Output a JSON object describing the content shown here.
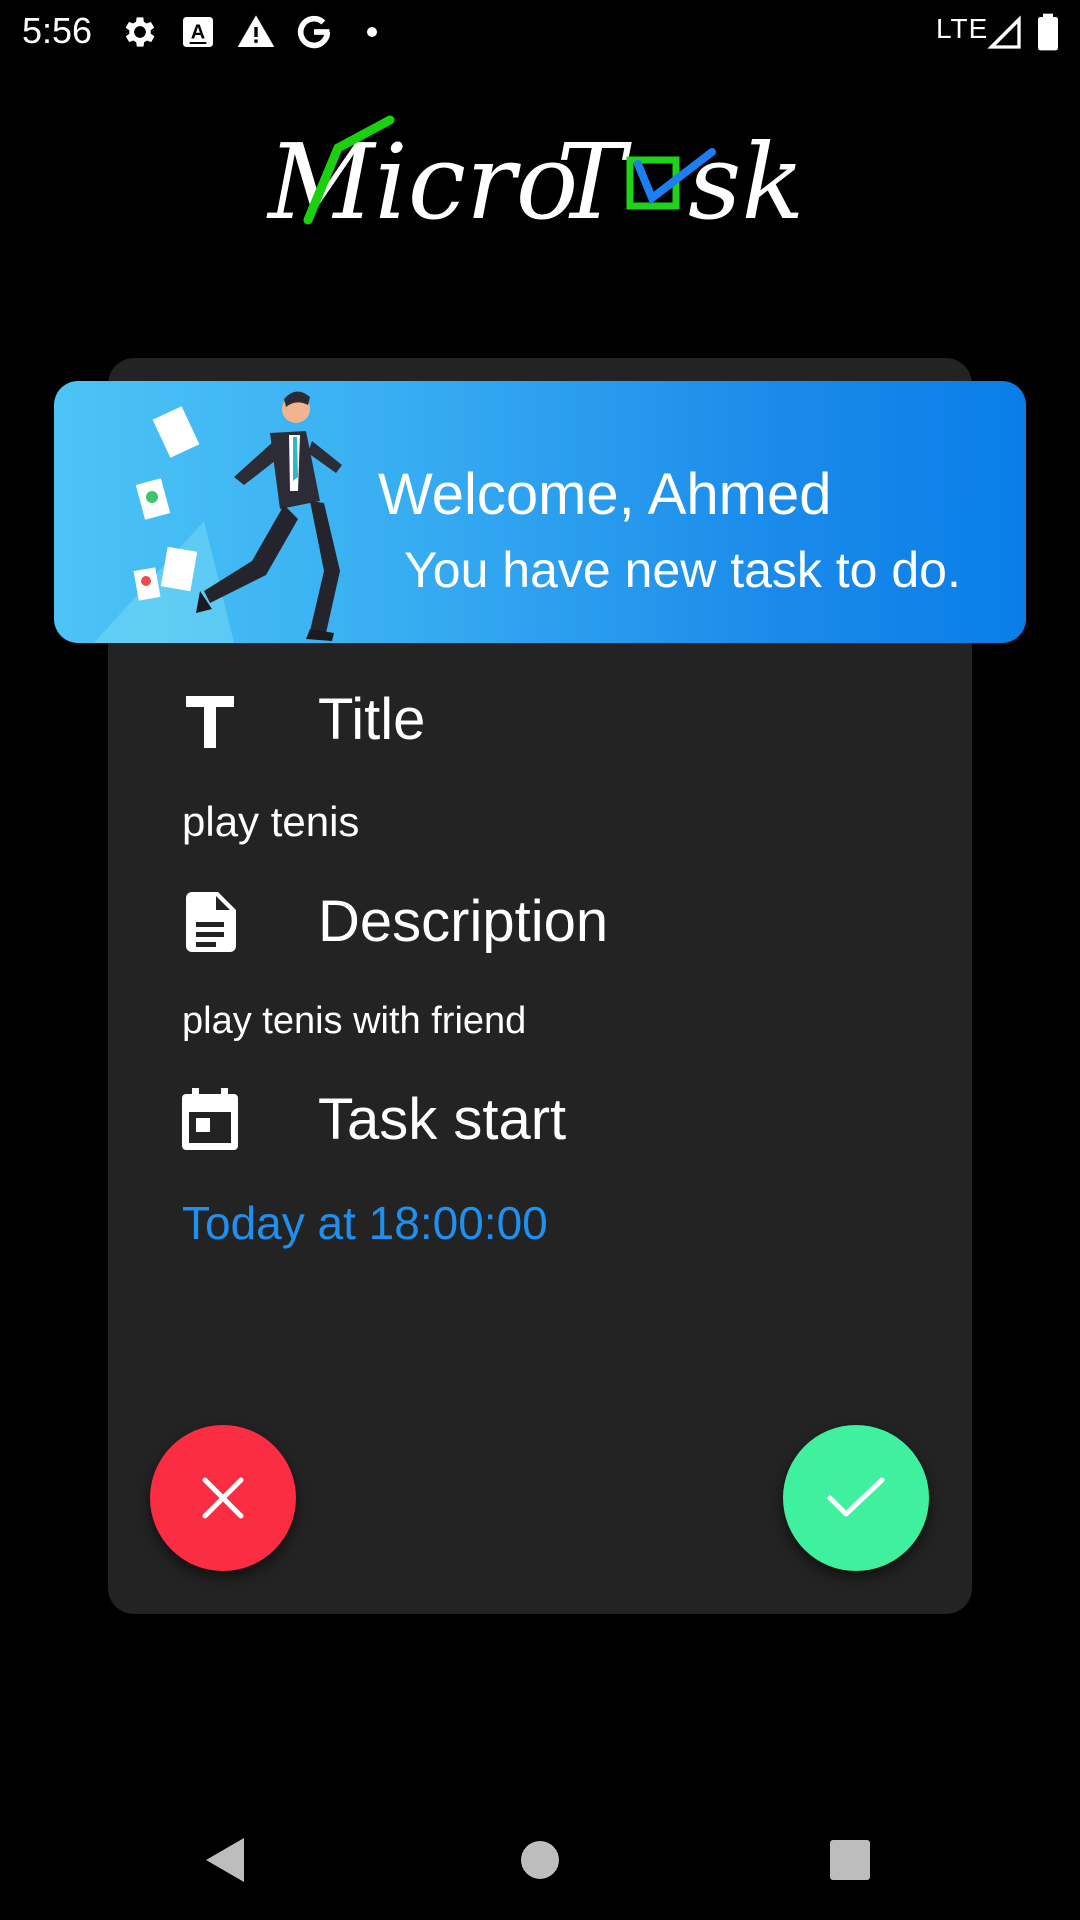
{
  "status_bar": {
    "time": "5:56",
    "network": "LTE",
    "icons": [
      "settings-icon",
      "text-recognition-icon",
      "warning-icon",
      "google-icon",
      "dot-icon",
      "signal-icon",
      "battery-icon"
    ]
  },
  "app": {
    "logo_text": "MicroTask",
    "colors": {
      "background": "#000000",
      "card": "#232323",
      "banner_start": "#4cc4f5",
      "banner_end": "#0a7ee8",
      "date_accent": "#1f8ff0",
      "reject": "#fb2d42",
      "accept": "#3ff19e"
    }
  },
  "banner": {
    "welcome": "Welcome, Ahmed",
    "subtitle": "You have new task to do."
  },
  "task": {
    "title_label": "Title",
    "title_value": "play tenis",
    "description_label": "Description",
    "description_value": "play tenis with friend",
    "start_label": "Task start",
    "start_value": "Today at 18:00:00"
  },
  "actions": {
    "reject_icon": "close-icon",
    "accept_icon": "check-icon"
  },
  "nav": {
    "icons": [
      "back-icon",
      "home-icon",
      "recents-icon"
    ]
  }
}
